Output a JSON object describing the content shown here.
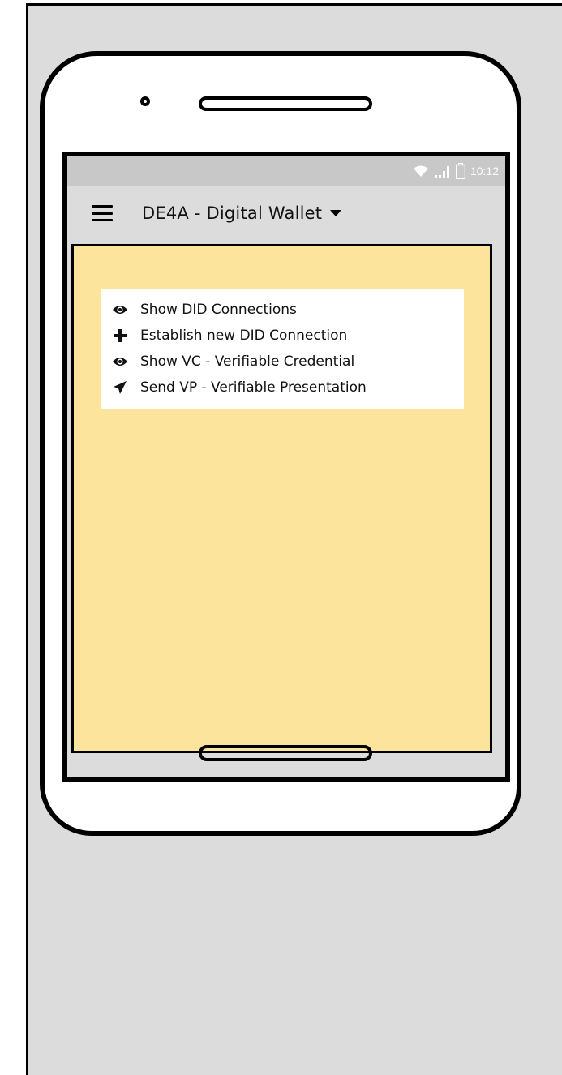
{
  "status_bar": {
    "time": "10:12"
  },
  "app_bar": {
    "title": "DE4A - Digital Wallet"
  },
  "actions": [
    {
      "label": "Show DID Connections",
      "icon": "eye-icon"
    },
    {
      "label": "Establish new DID Connection",
      "icon": "plus-icon"
    },
    {
      "label": "Show VC - Verifiable Credential",
      "icon": "eye-icon"
    },
    {
      "label": "Send VP - Verifiable Presentation",
      "icon": "send-icon"
    }
  ],
  "colors": {
    "content_background": "#fde49c",
    "chrome_background": "#dcdcdc",
    "status_bar_background": "#c8c8c8"
  }
}
